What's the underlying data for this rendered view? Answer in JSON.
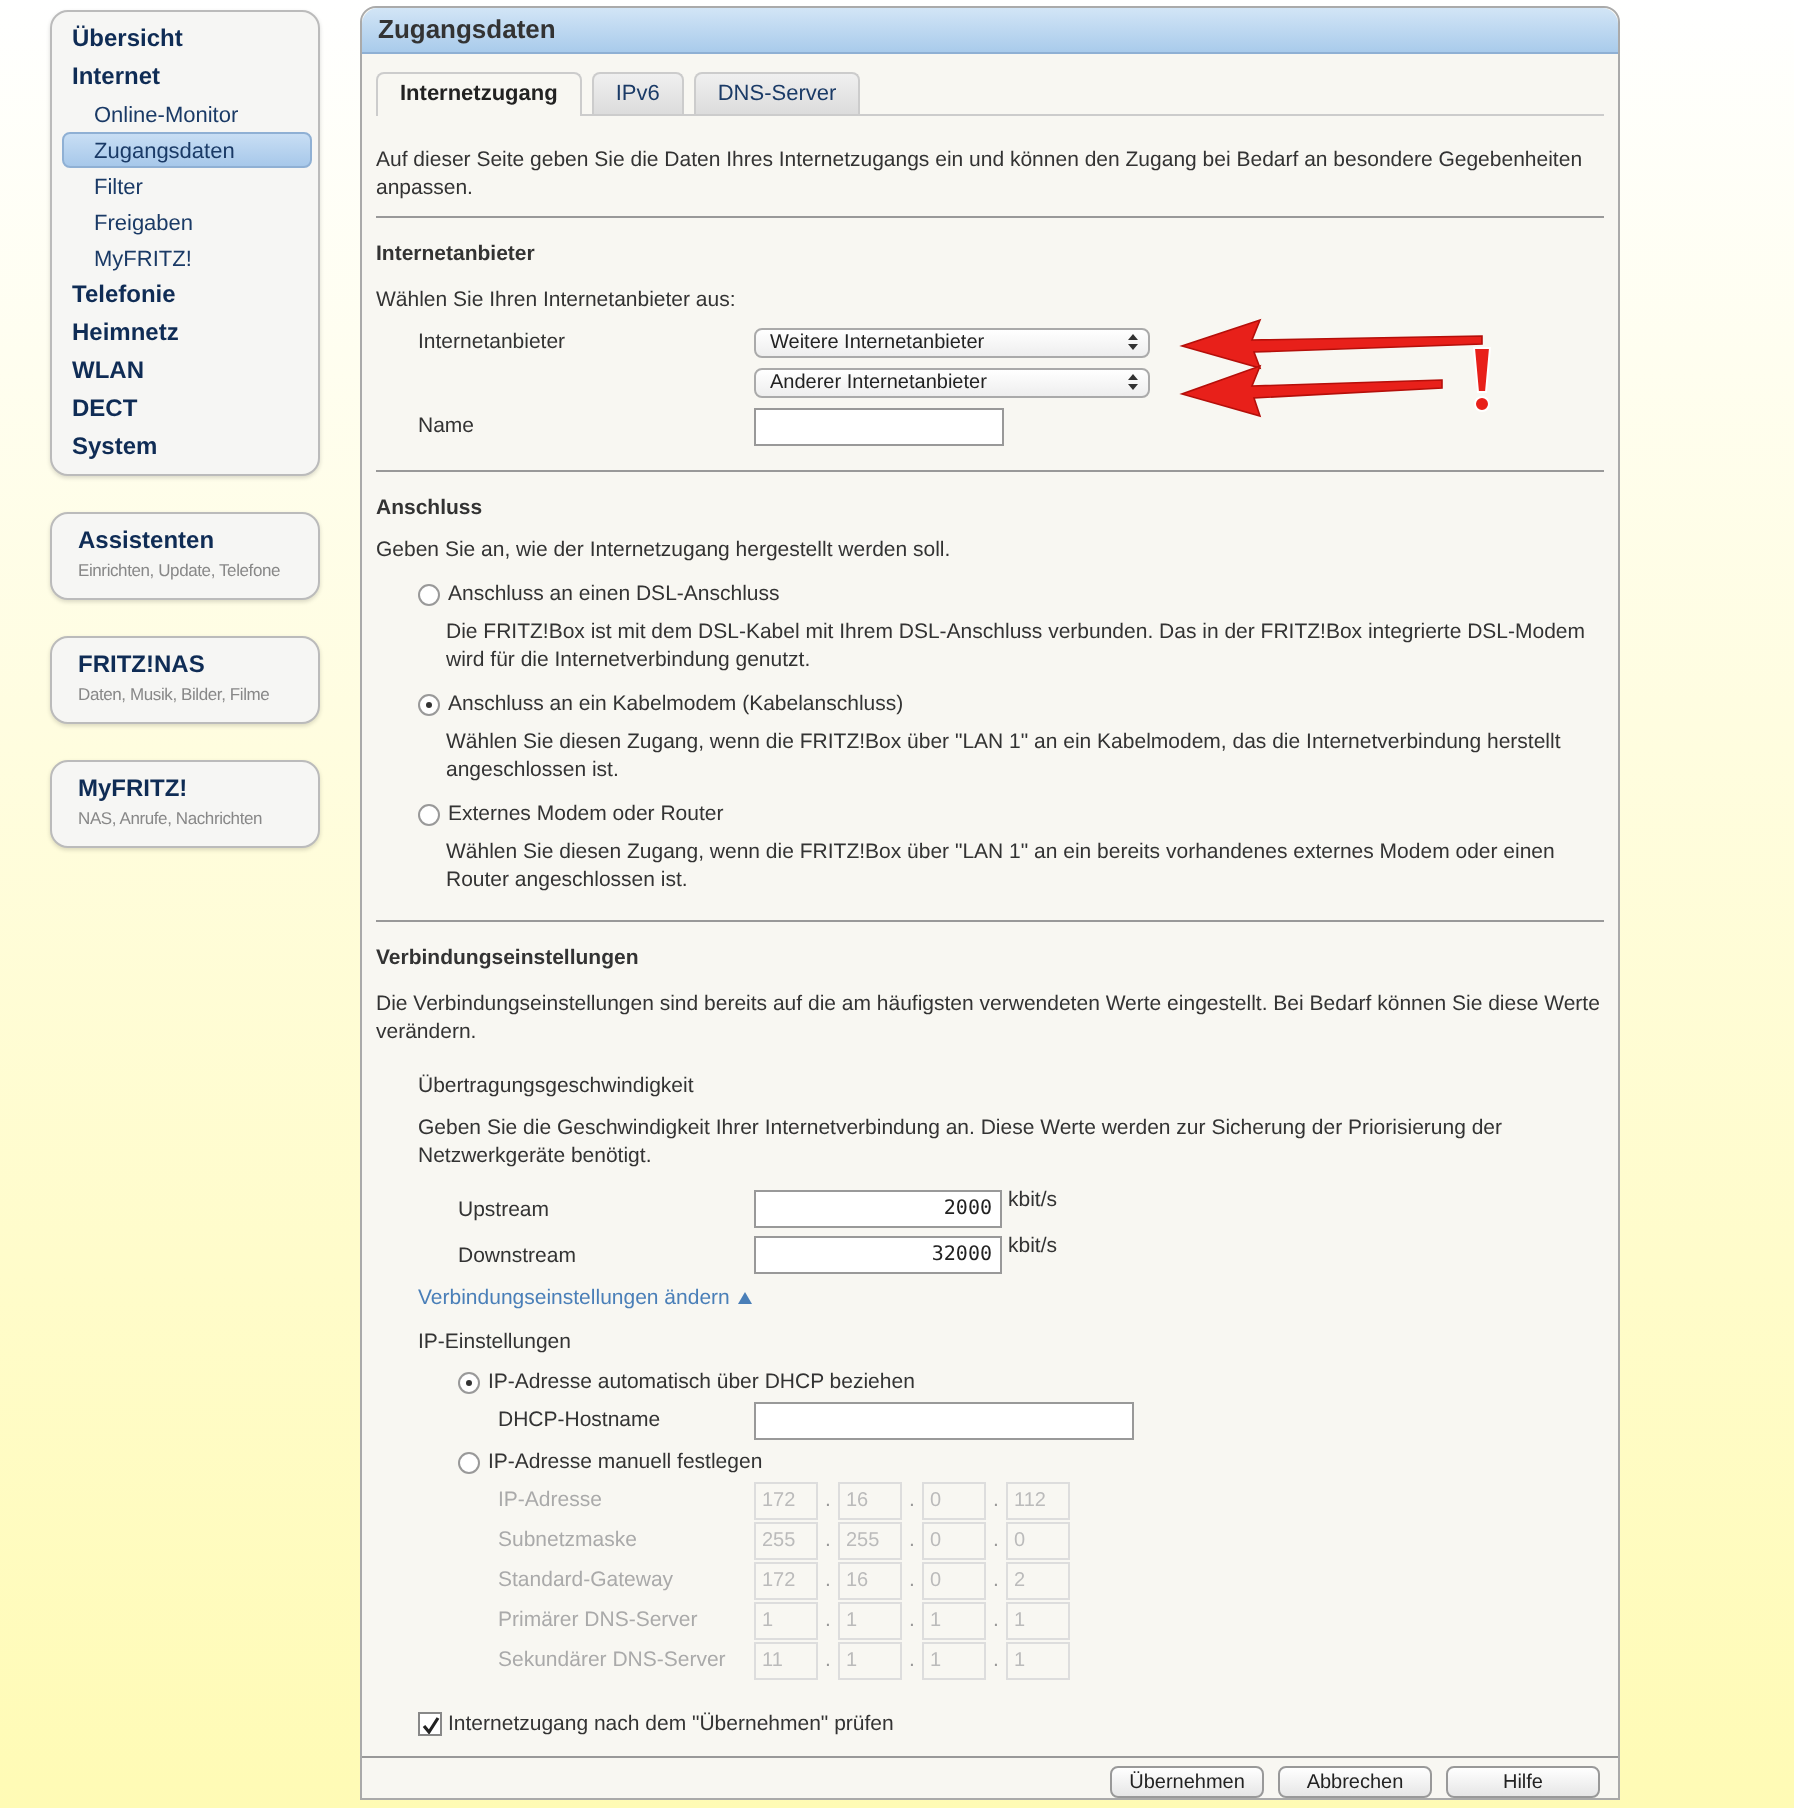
{
  "sidebar": {
    "menu": [
      {
        "label": "Übersicht",
        "selected": false
      },
      {
        "label": "Internet",
        "selected": false,
        "children": [
          {
            "label": "Online-Monitor",
            "selected": false
          },
          {
            "label": "Zugangsdaten",
            "selected": true
          },
          {
            "label": "Filter",
            "selected": false
          },
          {
            "label": "Freigaben",
            "selected": false
          },
          {
            "label": "MyFRITZ!",
            "selected": false
          }
        ]
      },
      {
        "label": "Telefonie",
        "selected": false
      },
      {
        "label": "Heimnetz",
        "selected": false
      },
      {
        "label": "WLAN",
        "selected": false
      },
      {
        "label": "DECT",
        "selected": false
      },
      {
        "label": "System",
        "selected": false
      }
    ],
    "cards": [
      {
        "title": "Assistenten",
        "subtitle": "Einrichten, Update, Telefone"
      },
      {
        "title": "FRITZ!NAS",
        "subtitle": "Daten, Musik, Bilder, Filme"
      },
      {
        "title": "MyFRITZ!",
        "subtitle": "NAS, Anrufe, Nachrichten"
      }
    ]
  },
  "panel": {
    "title": "Zugangsdaten",
    "tabs": [
      {
        "label": "Internetzugang",
        "selected": true
      },
      {
        "label": "IPv6",
        "selected": false
      },
      {
        "label": "DNS-Server",
        "selected": false
      }
    ],
    "intro": "Auf dieser Seite geben Sie die Daten Ihres Internetzugangs ein und können den Zugang bei Bedarf an besondere Gegebenheiten anpassen.",
    "provider": {
      "heading": "Internetanbieter",
      "prompt": "Wählen Sie Ihren Internetanbieter aus:",
      "label": "Internetanbieter",
      "selects": [
        "Weitere Internetanbieter",
        "Anderer Internetanbieter"
      ],
      "name_label": "Name"
    },
    "connection": {
      "heading": "Anschluss",
      "prompt": "Geben Sie an, wie der Internetzugang hergestellt werden soll.",
      "options": [
        {
          "label": "Anschluss an einen DSL-Anschluss",
          "description": "Die FRITZ!Box ist mit dem DSL-Kabel mit Ihrem DSL-Anschluss verbunden. Das in der FRITZ!Box integrierte DSL-Modem wird für die Internetverbindung genutzt.",
          "selected": false
        },
        {
          "label": "Anschluss an ein Kabelmodem (Kabelanschluss)",
          "description": "Wählen Sie diesen Zugang, wenn die FRITZ!Box über \"LAN 1\" an ein Kabelmodem, das die Internetverbindung herstellt angeschlossen ist.",
          "selected": true
        },
        {
          "label": "Externes Modem oder Router",
          "description": "Wählen Sie diesen Zugang, wenn die FRITZ!Box über \"LAN 1\" an ein bereits vorhandenes externes Modem oder einen Router angeschlossen ist.",
          "selected": false
        }
      ]
    },
    "settings": {
      "heading": "Verbindungseinstellungen",
      "intro": "Die Verbindungseinstellungen sind bereits auf die am häufigsten verwendeten Werte eingestellt. Bei Bedarf können Sie diese Werte verändern.",
      "speed": {
        "heading": "Übertragungsgeschwindigkeit",
        "text": "Geben Sie die Geschwindigkeit Ihrer Internetverbindung an. Diese Werte werden zur Sicherung der Priorisierung der Netzwerkgeräte benötigt.",
        "rows": [
          {
            "label": "Upstream",
            "value": "2000",
            "unit": "kbit/s"
          },
          {
            "label": "Downstream",
            "value": "32000",
            "unit": "kbit/s"
          }
        ]
      },
      "toggle": {
        "label": "Verbindungseinstellungen ändern",
        "expanded": true
      },
      "ip": {
        "heading": "IP-Einstellungen",
        "auto": {
          "label": "IP-Adresse automatisch über DHCP beziehen",
          "selected": true,
          "hostname_label": "DHCP-Hostname"
        },
        "manual": {
          "label": "IP-Adresse manuell festlegen",
          "selected": false,
          "disabled": true,
          "separator": ".",
          "rows": [
            {
              "label": "IP-Adresse",
              "octets": [
                "172",
                "16",
                "0",
                "112"
              ]
            },
            {
              "label": "Subnetzmaske",
              "octets": [
                "255",
                "255",
                "0",
                "0"
              ]
            },
            {
              "label": "Standard-Gateway",
              "octets": [
                "172",
                "16",
                "0",
                "2"
              ]
            },
            {
              "label": "Primärer DNS-Server",
              "octets": [
                "1",
                "1",
                "1",
                "1"
              ]
            },
            {
              "label": "Sekundärer DNS-Server",
              "octets": [
                "11",
                "1",
                "1",
                "1"
              ]
            }
          ]
        }
      }
    },
    "check": {
      "label": "Internetzugang nach dem \"Übernehmen\" prüfen",
      "checked": true
    },
    "buttons": [
      "Übernehmen",
      "Abbrechen",
      "Hilfe"
    ]
  }
}
